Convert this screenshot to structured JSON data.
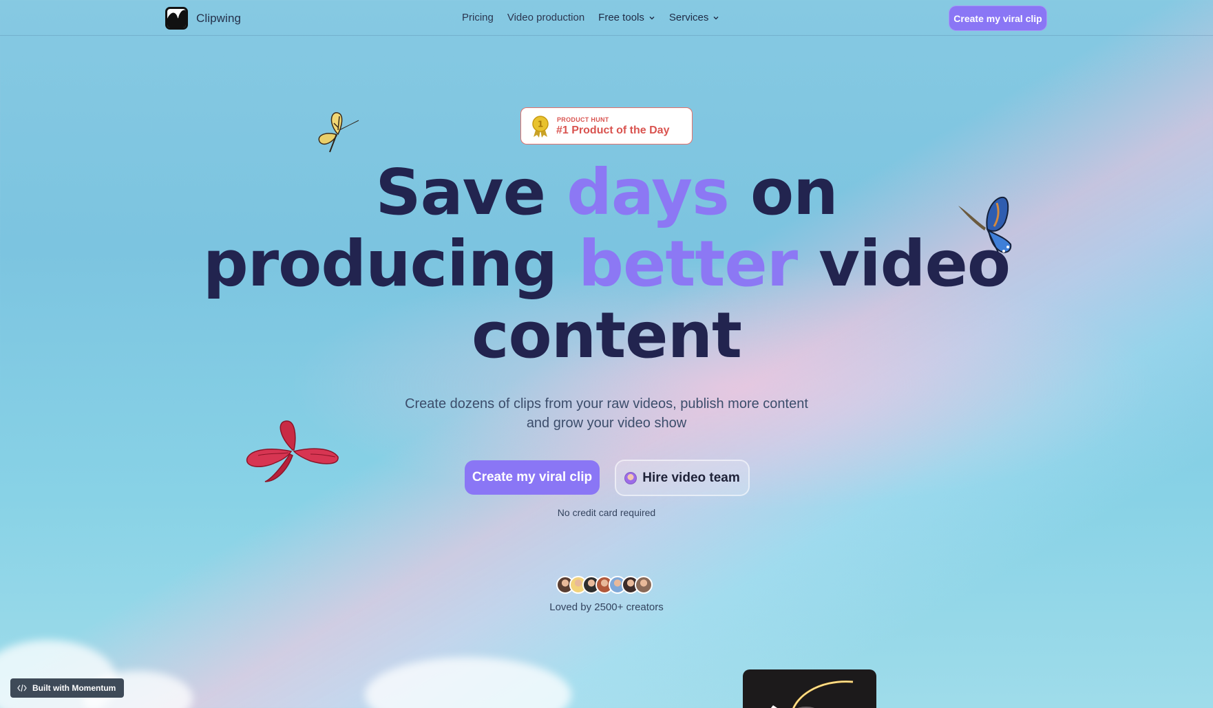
{
  "nav": {
    "brand_name": "Clipwing",
    "links": [
      "Pricing",
      "Video production"
    ],
    "dropdowns": [
      "Free tools",
      "Services"
    ],
    "cta_label": "Create my viral clip"
  },
  "badge": {
    "source": "PRODUCT HUNT",
    "title": "#1 Product of the Day",
    "medal_number": "1"
  },
  "hero": {
    "line1_a": "Save ",
    "line1_accent": "days",
    "line1_b": " on",
    "line2_a": "producing ",
    "line2_accent": "better",
    "line2_b": " video",
    "line3": "content",
    "subtitle_line1": "Create dozens of clips from your raw videos, publish more content",
    "subtitle_line2": "and grow your video show",
    "primary_cta": "Create my viral clip",
    "secondary_cta": "Hire video team",
    "note": "No credit card required"
  },
  "social_proof": {
    "label": "Loved by 2500+ creators",
    "avatar_colors": [
      "#5a3e32",
      "#f2d27a",
      "#2e2e2e",
      "#b1583a",
      "#7fa8d8",
      "#3d2c2a",
      "#8a6a58"
    ]
  },
  "footer_badge": {
    "label": "Built with Momentum",
    "icon": "code-icon"
  },
  "colors": {
    "accent": "#8a76f5",
    "headline": "#22244f",
    "badge_red": "#d9534f"
  }
}
